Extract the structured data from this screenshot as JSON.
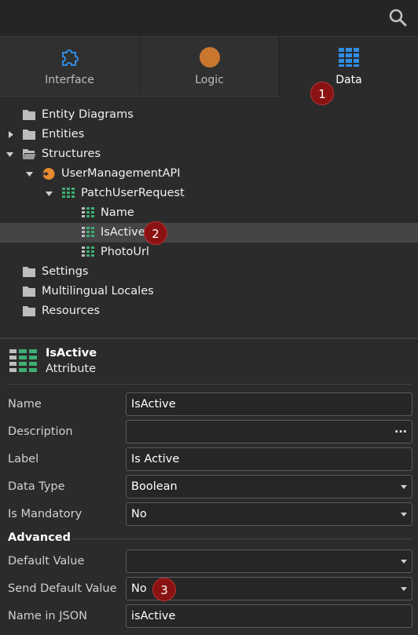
{
  "tabs": [
    {
      "label": "Interface",
      "icon": "puzzle-icon"
    },
    {
      "label": "Logic",
      "icon": "circle-icon"
    },
    {
      "label": "Data",
      "icon": "table-icon"
    }
  ],
  "badges": [
    "1",
    "2",
    "3"
  ],
  "tree": [
    {
      "label": "Entity Diagrams"
    },
    {
      "label": "Entities"
    },
    {
      "label": "Structures"
    },
    {
      "label": "UserManagementAPI"
    },
    {
      "label": "PatchUserRequest"
    },
    {
      "label": "Name"
    },
    {
      "label": "IsActive"
    },
    {
      "label": "PhotoUrl"
    },
    {
      "label": "Settings"
    },
    {
      "label": "Multilingual Locales"
    },
    {
      "label": "Resources"
    }
  ],
  "properties": {
    "title": "IsActive",
    "subtitle": "Attribute",
    "rows": [
      {
        "label": "Name",
        "value": "IsActive"
      },
      {
        "label": "Description",
        "value": "",
        "button": "..."
      },
      {
        "label": "Label",
        "value": "Is Active"
      },
      {
        "label": "Data Type",
        "value": "Boolean"
      },
      {
        "label": "Is Mandatory",
        "value": "No"
      }
    ],
    "advanced_label": "Advanced",
    "advanced_rows": [
      {
        "label": "Default Value",
        "value": ""
      },
      {
        "label": "Send Default Value",
        "value": "No"
      },
      {
        "label": "Name in JSON",
        "value": "isActive"
      }
    ]
  },
  "colors": {
    "accent_blue": "#2f8de4",
    "logic_orange": "#c9772f",
    "attribute_green": "#3fae73",
    "badge_red": "#8a1212"
  }
}
